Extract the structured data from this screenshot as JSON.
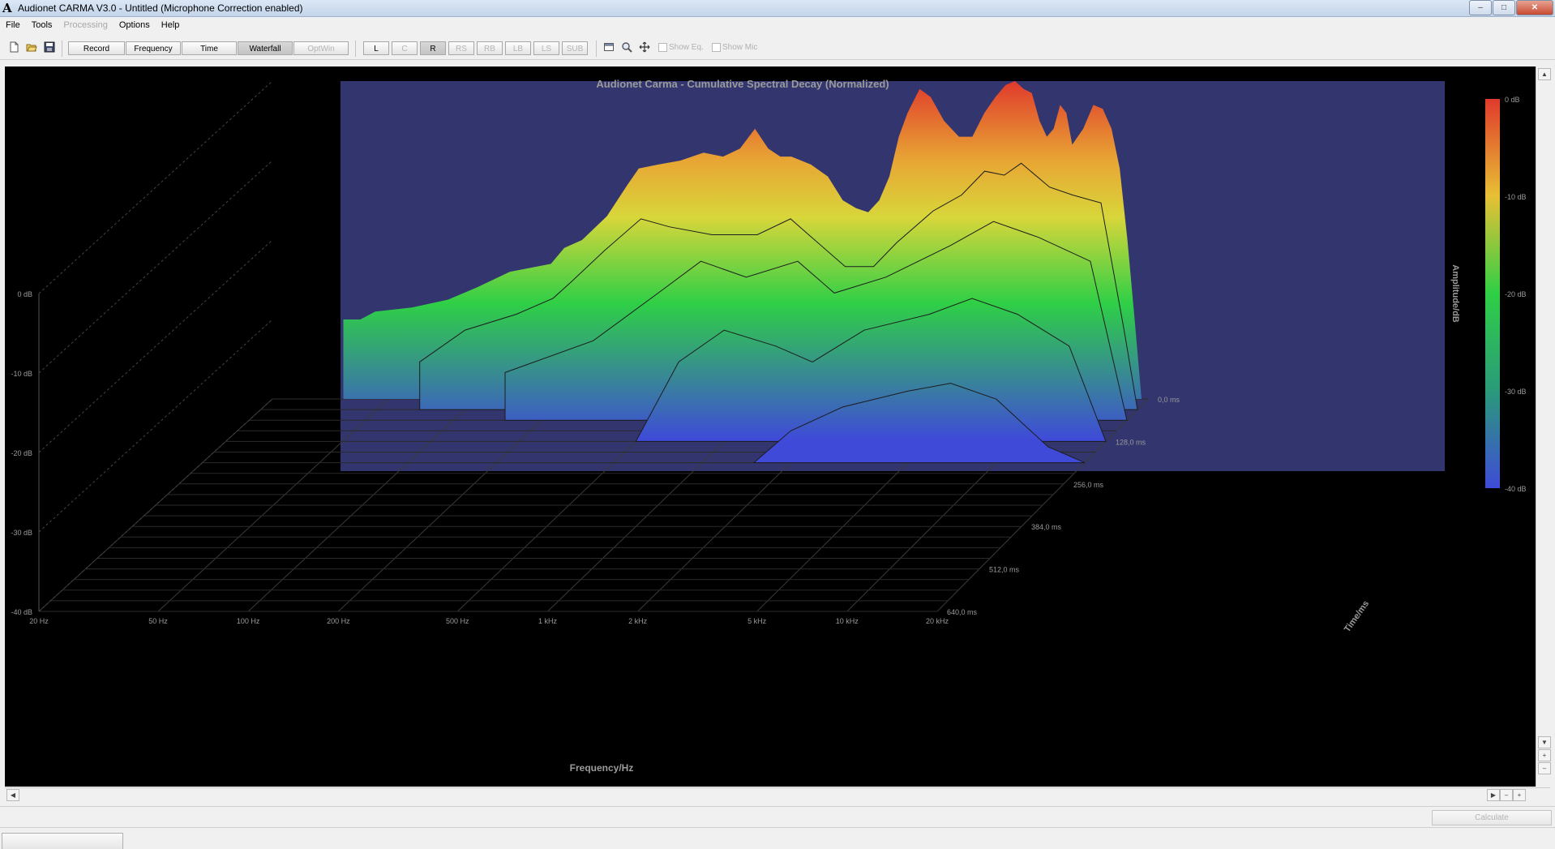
{
  "window": {
    "app_icon": "A",
    "title": "Audionet CARMA V3.0 - Untitled (Microphone Correction enabled)"
  },
  "menu": [
    {
      "label": "File",
      "enabled": true
    },
    {
      "label": "Tools",
      "enabled": true
    },
    {
      "label": "Processing",
      "enabled": false
    },
    {
      "label": "Options",
      "enabled": true
    },
    {
      "label": "Help",
      "enabled": true
    }
  ],
  "toolbar": {
    "record": "Record",
    "frequency": "Frequency",
    "time": "Time",
    "waterfall": "Waterfall",
    "optwin": "OptWin",
    "channels": [
      "L",
      "C",
      "R",
      "RS",
      "RB",
      "LB",
      "LS",
      "SUB"
    ],
    "active_channel": "R",
    "show_eq": "Show Eq.",
    "show_mic": "Show Mic"
  },
  "icons": [
    "new-file-icon",
    "open-folder-icon",
    "save-disk-icon",
    "window-icon",
    "zoom-icon",
    "pan-move-icon"
  ],
  "chart_data": {
    "type": "area",
    "title": "Audionet Carma - Cumulative Spectral Decay (Normalized)",
    "xlabel": "Frequency/Hz",
    "ylabel": "Amplitude/dB",
    "zlabel": "Time/ms",
    "x_ticks": [
      "20 Hz",
      "50 Hz",
      "100 Hz",
      "200 Hz",
      "500 Hz",
      "1 kHz",
      "2 kHz",
      "5 kHz",
      "10 kHz",
      "20 kHz"
    ],
    "y_ticks": [
      "0 dB",
      "-10 dB",
      "-20 dB",
      "-30 dB",
      "-40 dB"
    ],
    "time_ticks": [
      "0,0 ms",
      "128,0 ms",
      "256,0 ms",
      "384,0 ms",
      "512,0 ms",
      "640,0 ms"
    ],
    "colorbar_ticks": [
      "0 dB",
      "-10 dB",
      "-20 dB",
      "-30 dB",
      "-40 dB"
    ],
    "xscale": "log",
    "xlim": [
      20,
      20000
    ],
    "ylim": [
      -40,
      0
    ],
    "tlim": [
      0,
      640
    ],
    "colormap": [
      "#3f4bd8",
      "#2fcf46",
      "#d8d63a",
      "#e8a534",
      "#e03a2c"
    ],
    "background": "#33356e",
    "series": [
      {
        "time_ms": 0,
        "freq_hz": [
          35,
          40,
          45,
          60,
          80,
          100,
          130,
          180,
          200,
          230,
          280,
          330,
          360,
          420,
          500,
          600,
          700,
          800,
          900,
          1000,
          1100,
          1200,
          1400,
          1600,
          1800,
          2000,
          2200,
          2400,
          2600,
          2800,
          3000,
          3300,
          3600,
          4000,
          4500,
          5000,
          5500,
          6000,
          6500,
          7000,
          7500,
          8000,
          8500,
          9000,
          9500,
          10000,
          10500,
          11000,
          12000,
          13000,
          14000,
          15000,
          16000,
          17000,
          18000,
          19000,
          20000
        ],
        "db": [
          -30,
          -30,
          -29,
          -28.5,
          -27.5,
          -26,
          -24,
          -23,
          -21,
          -20,
          -17,
          -13,
          -11,
          -10.5,
          -10,
          -9,
          -9.5,
          -8.5,
          -6,
          -8.5,
          -9.5,
          -9.5,
          -10.5,
          -12,
          -15,
          -16,
          -16.5,
          -15,
          -12,
          -7,
          -4,
          -1,
          -2,
          -5,
          -7,
          -7,
          -4,
          -2,
          -0.5,
          0,
          -1,
          -1.5,
          -5,
          -7,
          -6,
          -3,
          -4,
          -8,
          -6,
          -3,
          -3.5,
          -6,
          -11,
          -20,
          -30,
          -40,
          -40
        ]
      },
      {
        "time_ms": 32,
        "freq_hz": [
          70,
          100,
          150,
          200,
          230,
          300,
          400,
          500,
          700,
          1000,
          1300,
          1500,
          2000,
          2500,
          3000,
          4000,
          5000,
          6000,
          7000,
          8000,
          10000,
          12000,
          15000,
          18000,
          20000
        ],
        "db": [
          -34,
          -30,
          -28,
          -26,
          -24,
          -20,
          -16,
          -17,
          -18,
          -18,
          -16,
          -18,
          -22,
          -22,
          -19,
          -15,
          -13,
          -10,
          -10.5,
          -9,
          -12,
          -13,
          -14,
          -30,
          -40
        ]
      },
      {
        "time_ms": 64,
        "freq_hz": [
          150,
          300,
          500,
          700,
          1000,
          1500,
          2000,
          3000,
          5000,
          7000,
          10000,
          15000,
          20000
        ],
        "db": [
          -34,
          -30,
          -24,
          -20,
          -22,
          -20,
          -24,
          -22,
          -18,
          -15,
          -17,
          -20,
          -40
        ]
      },
      {
        "time_ms": 128,
        "freq_hz": [
          500,
          700,
          1000,
          1500,
          2000,
          3000,
          5000,
          7000,
          10000,
          15000,
          20000
        ],
        "db": [
          -40,
          -30,
          -26,
          -28,
          -30,
          -26,
          -24,
          -22,
          -24,
          -28,
          -40
        ]
      },
      {
        "time_ms": 192,
        "freq_hz": [
          1500,
          2000,
          3000,
          5000,
          7000,
          10000,
          15000,
          20000
        ],
        "db": [
          -40,
          -36,
          -33,
          -31,
          -30,
          -32,
          -38,
          -40
        ]
      }
    ]
  }
}
